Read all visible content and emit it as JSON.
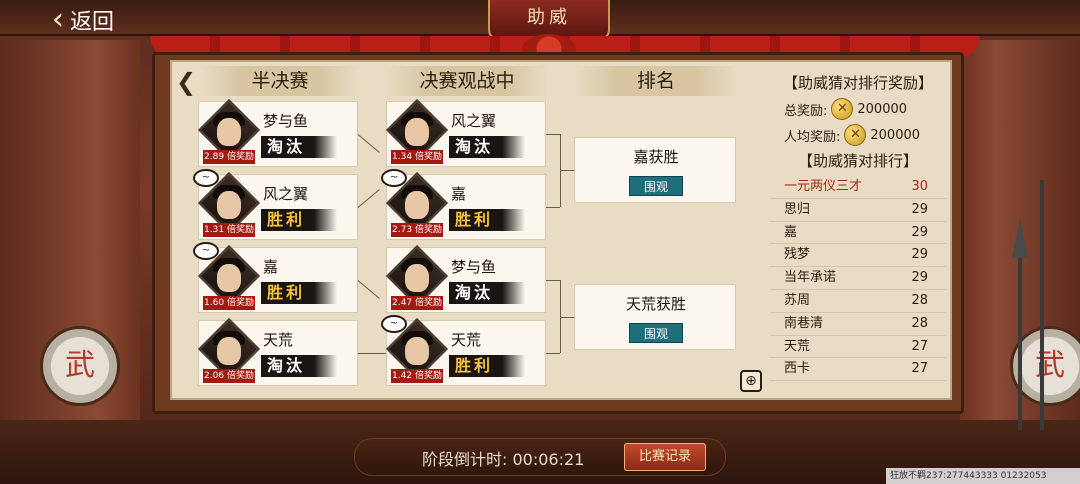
{
  "header": {
    "back_label": "返回",
    "title": "助威"
  },
  "columns": {
    "semifinal": "半决赛",
    "final_live": "决赛观战中",
    "ranking": "排名"
  },
  "semifinal": [
    {
      "name": "梦与鱼",
      "odds": "2.89 倍奖励",
      "result": "淘汰",
      "cheered": false
    },
    {
      "name": "风之翼",
      "odds": "1.31 倍奖励",
      "result": "胜利",
      "cheered": true
    },
    {
      "name": "嘉",
      "odds": "1.60 倍奖励",
      "result": "胜利",
      "cheered": true
    },
    {
      "name": "天荒",
      "odds": "2.06 倍奖励",
      "result": "淘汰",
      "cheered": false
    }
  ],
  "final": [
    {
      "name": "风之翼",
      "odds": "1.34 倍奖励",
      "result": "淘汰",
      "cheered": false
    },
    {
      "name": "嘉",
      "odds": "2.73 倍奖励",
      "result": "胜利",
      "cheered": true
    },
    {
      "name": "梦与鱼",
      "odds": "2.47 倍奖励",
      "result": "淘汰",
      "cheered": false
    },
    {
      "name": "天荒",
      "odds": "1.42 倍奖励",
      "result": "胜利",
      "cheered": true
    }
  ],
  "outcomes": [
    {
      "text": "嘉获胜",
      "watch_label": "围观"
    },
    {
      "text": "天荒获胜",
      "watch_label": "围观"
    }
  ],
  "rewards": {
    "title": "【助威猜对排行奖励】",
    "total_label": "总奖励:",
    "total_value": "200000",
    "avg_label": "人均奖励:",
    "avg_value": "200000",
    "coin_icon": "coin-icon"
  },
  "ranking": {
    "title": "【助威猜对排行】",
    "items": [
      {
        "name": "一元两仪三才",
        "score": "30"
      },
      {
        "name": "思归",
        "score": "29"
      },
      {
        "name": "嘉",
        "score": "29"
      },
      {
        "name": "残梦",
        "score": "29"
      },
      {
        "name": "当年承诺",
        "score": "29"
      },
      {
        "name": "苏周",
        "score": "28"
      },
      {
        "name": "南巷清",
        "score": "28"
      },
      {
        "name": "天荒",
        "score": "27"
      },
      {
        "name": "西卡",
        "score": "27"
      }
    ]
  },
  "footer": {
    "countdown_label": "阶段倒计时:",
    "countdown_value": "00:06:21",
    "record_label": "比赛记录"
  },
  "watermark": "狂放不羁237:277443333 01232053",
  "drum_char": "武",
  "cheer_icon": "~",
  "colors": {
    "win": "#f6c33a",
    "lose": "#ffffff",
    "odds_badge": "#a31a12",
    "watch_button": "#1f6e7c",
    "top_rank": "#a3291a"
  }
}
